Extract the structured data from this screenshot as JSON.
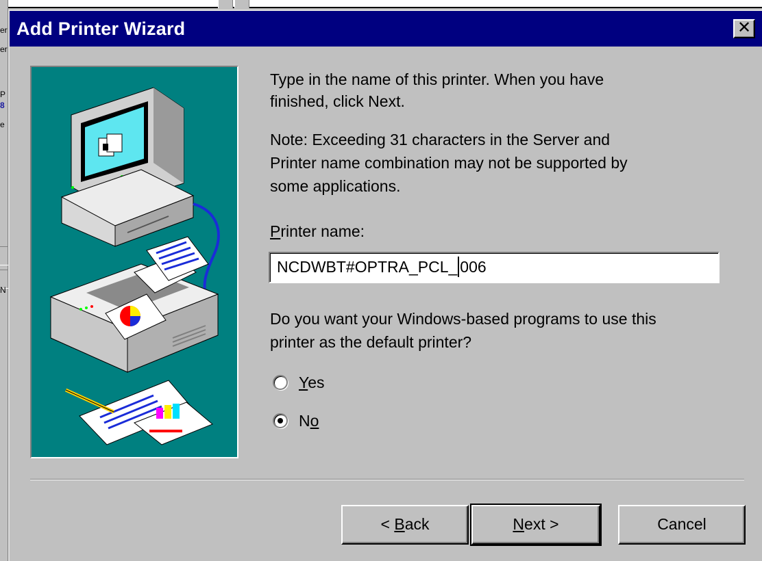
{
  "background": {
    "fragments": [
      "er",
      "er",
      "P",
      "8",
      "e",
      "N"
    ]
  },
  "dialog": {
    "title": "Add Printer Wizard",
    "close_icon": "close-icon",
    "instruction_line1": "Type in the name of this printer.  When you have",
    "instruction_line2": "finished, click Next.",
    "note_line1": "Note:  Exceeding 31 characters in the Server and",
    "note_line2": "Printer name combination may not be supported by",
    "note_line3": "some applications.",
    "printer_name_label_accel": "P",
    "printer_name_label_rest": "rinter name:",
    "printer_name_before_caret": "NCDWBT#OPTRA_PCL_",
    "printer_name_after_caret": "006",
    "default_question_line1": "Do you want your Windows-based programs to use this",
    "default_question_line2": "printer as the default printer?",
    "radio_yes": {
      "accel": "Y",
      "rest": "es",
      "selected": false
    },
    "radio_no": {
      "pre": "N",
      "accel": "o",
      "selected": true
    },
    "buttons": {
      "back_pre": "< ",
      "back_accel": "B",
      "back_rest": "ack",
      "next_accel": "N",
      "next_rest": "ext >",
      "cancel": "Cancel"
    },
    "colors": {
      "titlebar": "#000080",
      "illustration_bg": "#008080",
      "face": "#c0c0c0"
    }
  }
}
